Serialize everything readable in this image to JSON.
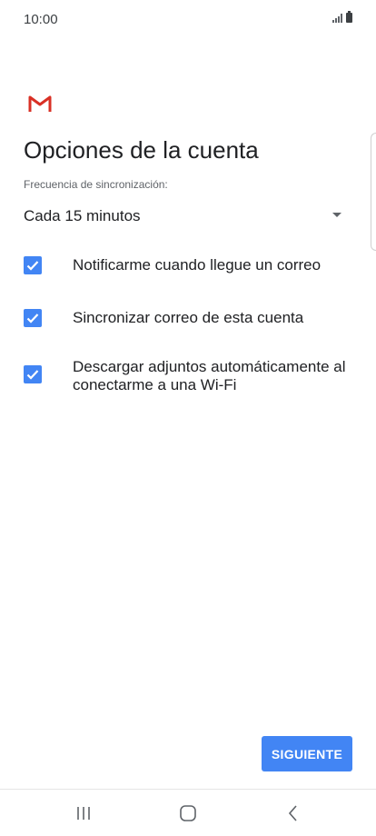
{
  "status_bar": {
    "time": "10:00"
  },
  "header": {
    "logo_icon": "gmail-m-icon",
    "title": "Opciones de la cuenta"
  },
  "sync": {
    "label": "Frecuencia de sincronización:",
    "value": "Cada 15 minutos"
  },
  "options": [
    {
      "label": "Notificarme cuando llegue un correo",
      "checked": true
    },
    {
      "label": "Sincronizar correo de esta cuenta",
      "checked": true
    },
    {
      "label": "Descargar adjuntos automáticamente al conectarme a una Wi-Fi",
      "checked": true
    }
  ],
  "actions": {
    "next_label": "SIGUIENTE"
  },
  "colors": {
    "accent": "#4285f4",
    "gmail_red": "#d93025"
  },
  "nav": {
    "recent_icon": "recent-apps-icon",
    "home_icon": "home-icon",
    "back_icon": "back-icon"
  }
}
